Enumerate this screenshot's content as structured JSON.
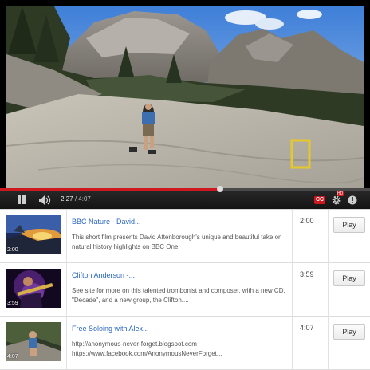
{
  "player": {
    "time_current": "2:27",
    "time_separator": "/",
    "time_total": "4:07",
    "progress": 0.595,
    "cc_label": "CC",
    "hd_label": "HD",
    "icons": [
      "pause-icon",
      "volume-icon",
      "closed-captions-icon",
      "settings-icon",
      "help-icon"
    ]
  },
  "playlist": {
    "rows": [
      {
        "title": "BBC Nature - David...",
        "description": "This short film presents David Attenborough's unique and beautiful take on natural history highlights on BBC One.",
        "duration": "2:00",
        "thumb_duration": "2:00",
        "play_label": "Play"
      },
      {
        "title": "Clifton Anderson -...",
        "description": "See site for more on this talented trombonist and composer, with a new CD, \"Decade\", and a new group, the Clifton....",
        "duration": "3:59",
        "thumb_duration": "3:59",
        "play_label": "Play"
      },
      {
        "title": "Free Soloing with Alex...",
        "description_lines": [
          "http://anonymous-never-forget.blogspot.com",
          "https://www.facebook.com/AnonymousNeverForget..."
        ],
        "duration": "4:07",
        "thumb_duration": "4:07",
        "play_label": "Play"
      }
    ]
  }
}
